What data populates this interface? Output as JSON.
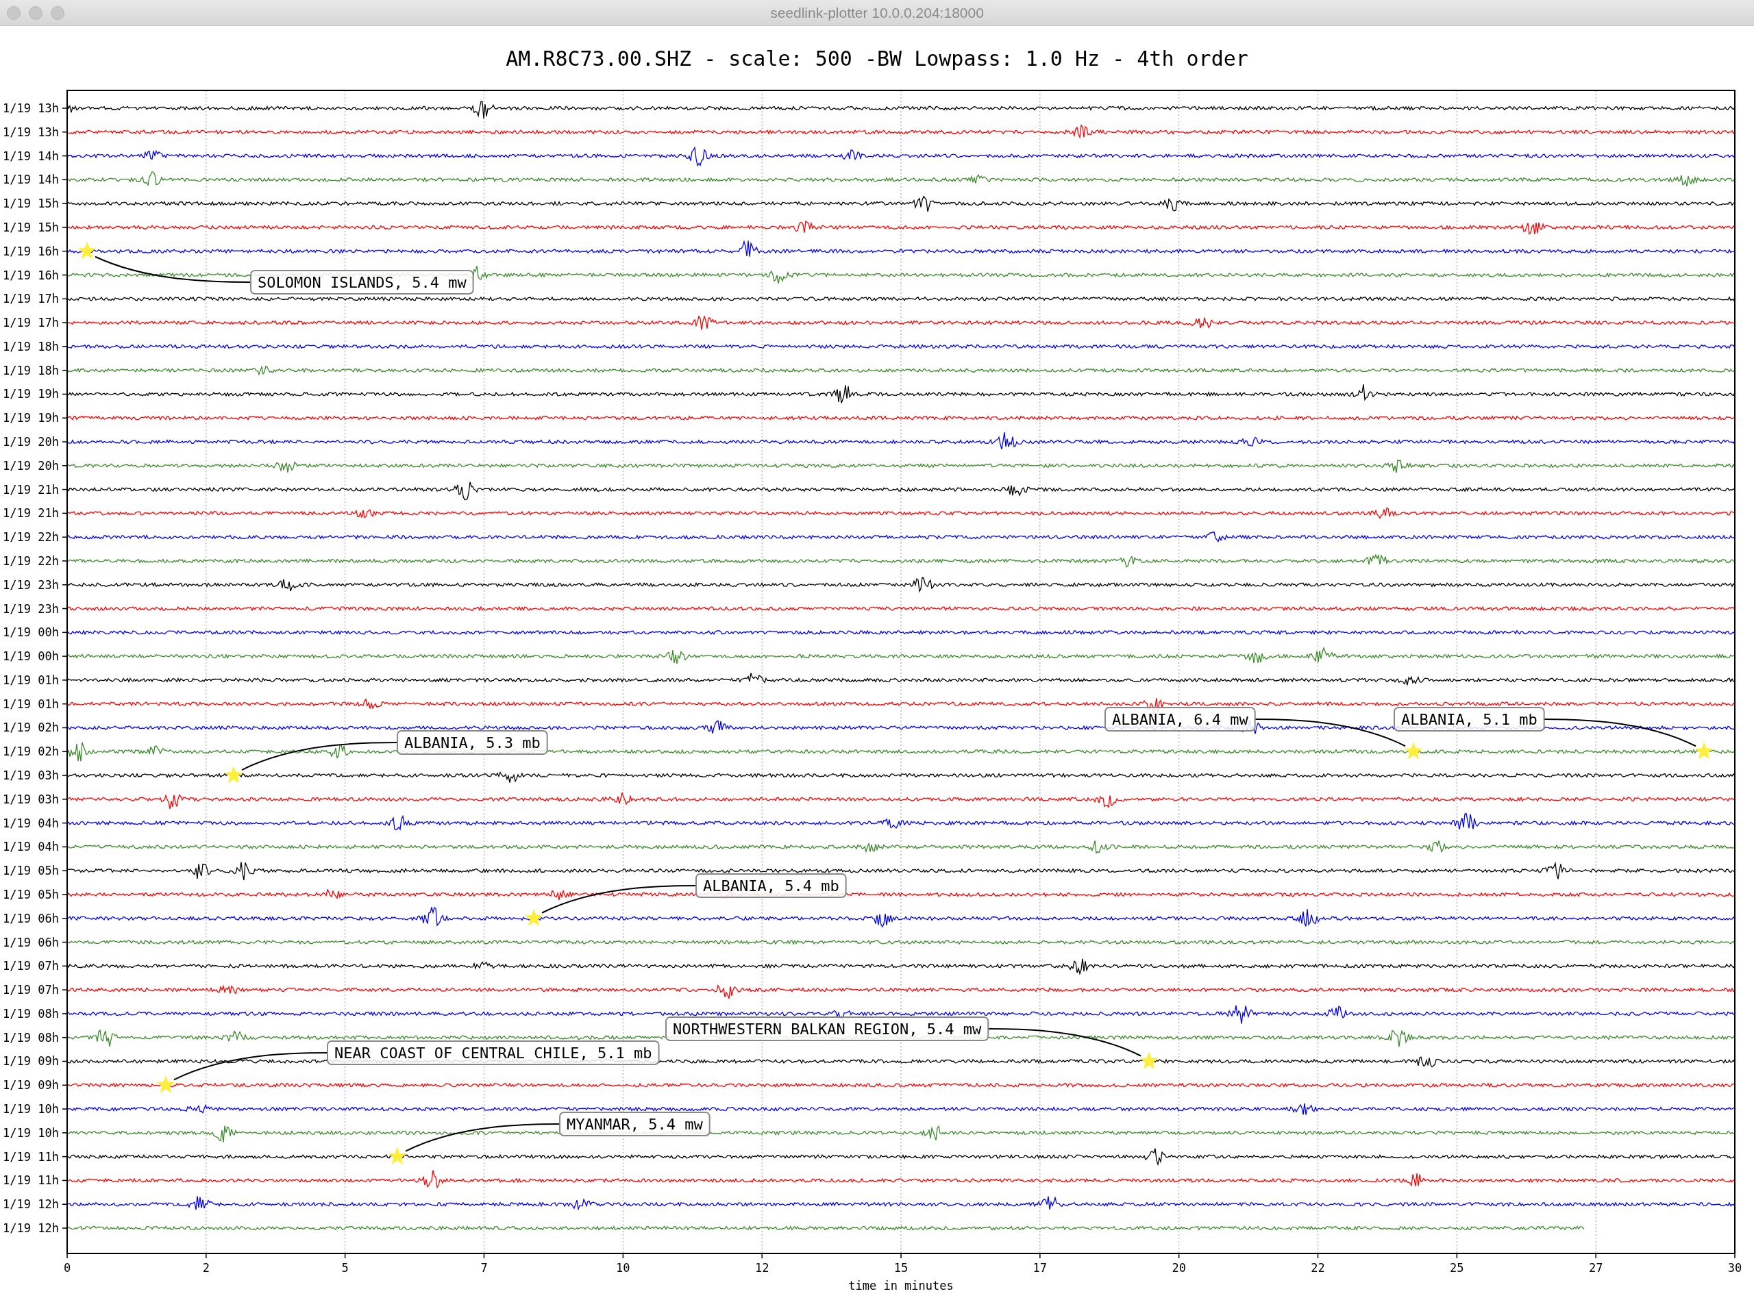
{
  "window": {
    "title": "seedlink-plotter 10.0.0.204:18000"
  },
  "plot": {
    "title": "AM.R8C73.00.SHZ - scale: 500 -BW Lowpass: 1.0 Hz - 4th order",
    "xlabel": "time in minutes",
    "xticks": [
      "0",
      "2",
      "5",
      "7",
      "10",
      "12",
      "15",
      "17",
      "20",
      "22",
      "25",
      "27",
      "30"
    ],
    "rows": [
      {
        "label": "1/19 13h",
        "color": "#000000"
      },
      {
        "label": "1/19 13h",
        "color": "#ff0000"
      },
      {
        "label": "1/19 14h",
        "color": "#0000ff"
      },
      {
        "label": "1/19 14h",
        "color": "#3a8a2a"
      },
      {
        "label": "1/19 15h",
        "color": "#000000"
      },
      {
        "label": "1/19 15h",
        "color": "#ff0000"
      },
      {
        "label": "1/19 16h",
        "color": "#0000ff"
      },
      {
        "label": "1/19 16h",
        "color": "#3a8a2a"
      },
      {
        "label": "1/19 17h",
        "color": "#000000"
      },
      {
        "label": "1/19 17h",
        "color": "#ff0000"
      },
      {
        "label": "1/19 18h",
        "color": "#0000ff"
      },
      {
        "label": "1/19 18h",
        "color": "#3a8a2a"
      },
      {
        "label": "1/19 19h",
        "color": "#000000"
      },
      {
        "label": "1/19 19h",
        "color": "#ff0000"
      },
      {
        "label": "1/19 20h",
        "color": "#0000ff"
      },
      {
        "label": "1/19 20h",
        "color": "#3a8a2a"
      },
      {
        "label": "1/19 21h",
        "color": "#000000"
      },
      {
        "label": "1/19 21h",
        "color": "#ff0000"
      },
      {
        "label": "1/19 22h",
        "color": "#0000ff"
      },
      {
        "label": "1/19 22h",
        "color": "#3a8a2a"
      },
      {
        "label": "1/19 23h",
        "color": "#000000"
      },
      {
        "label": "1/19 23h",
        "color": "#ff0000"
      },
      {
        "label": "1/19 00h",
        "color": "#0000ff"
      },
      {
        "label": "1/19 00h",
        "color": "#3a8a2a"
      },
      {
        "label": "1/19 01h",
        "color": "#000000"
      },
      {
        "label": "1/19 01h",
        "color": "#ff0000"
      },
      {
        "label": "1/19 02h",
        "color": "#0000ff"
      },
      {
        "label": "1/19 02h",
        "color": "#3a8a2a"
      },
      {
        "label": "1/19 03h",
        "color": "#000000"
      },
      {
        "label": "1/19 03h",
        "color": "#ff0000"
      },
      {
        "label": "1/19 04h",
        "color": "#0000ff"
      },
      {
        "label": "1/19 04h",
        "color": "#3a8a2a"
      },
      {
        "label": "1/19 05h",
        "color": "#000000"
      },
      {
        "label": "1/19 05h",
        "color": "#ff0000"
      },
      {
        "label": "1/19 06h",
        "color": "#0000ff"
      },
      {
        "label": "1/19 06h",
        "color": "#3a8a2a"
      },
      {
        "label": "1/19 07h",
        "color": "#000000"
      },
      {
        "label": "1/19 07h",
        "color": "#ff0000"
      },
      {
        "label": "1/19 08h",
        "color": "#0000ff"
      },
      {
        "label": "1/19 08h",
        "color": "#3a8a2a"
      },
      {
        "label": "1/19 09h",
        "color": "#000000"
      },
      {
        "label": "1/19 09h",
        "color": "#ff0000"
      },
      {
        "label": "1/19 10h",
        "color": "#0000ff"
      },
      {
        "label": "1/19 10h",
        "color": "#3a8a2a"
      },
      {
        "label": "1/19 11h",
        "color": "#000000"
      },
      {
        "label": "1/19 11h",
        "color": "#ff0000"
      },
      {
        "label": "1/19 12h",
        "color": "#0000ff"
      },
      {
        "label": "1/19 12h",
        "color": "#3a8a2a"
      }
    ],
    "events": [
      {
        "label": "SOLOMON ISLANDS, 5.4 mw"
      },
      {
        "label": "ALBANIA, 5.3 mb"
      },
      {
        "label": "ALBANIA, 6.4 mw"
      },
      {
        "label": "ALBANIA, 5.1 mb"
      },
      {
        "label": "ALBANIA, 5.4 mb"
      },
      {
        "label": "NORTHWESTERN BALKAN REGION, 5.4 mw"
      },
      {
        "label": "NEAR COAST OF CENTRAL CHILE, 5.1 mb"
      },
      {
        "label": "MYANMAR, 5.4 mw"
      }
    ]
  }
}
